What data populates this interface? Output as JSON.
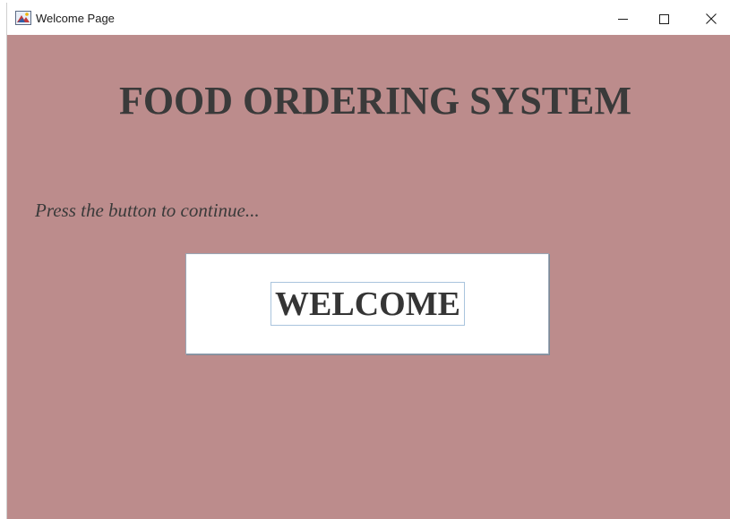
{
  "window": {
    "title": "Welcome Page",
    "icon": "java-app-icon",
    "controls": {
      "minimize": "minimize-icon",
      "maximize": "maximize-icon",
      "close": "close-icon"
    }
  },
  "main": {
    "heading": "FOOD ORDERING SYSTEM",
    "instruction": "Press the button to continue...",
    "welcome_button_label": "WELCOME"
  },
  "colors": {
    "background": "#bc8c8c",
    "text": "#3a3a3a",
    "button_background": "#ffffff"
  }
}
